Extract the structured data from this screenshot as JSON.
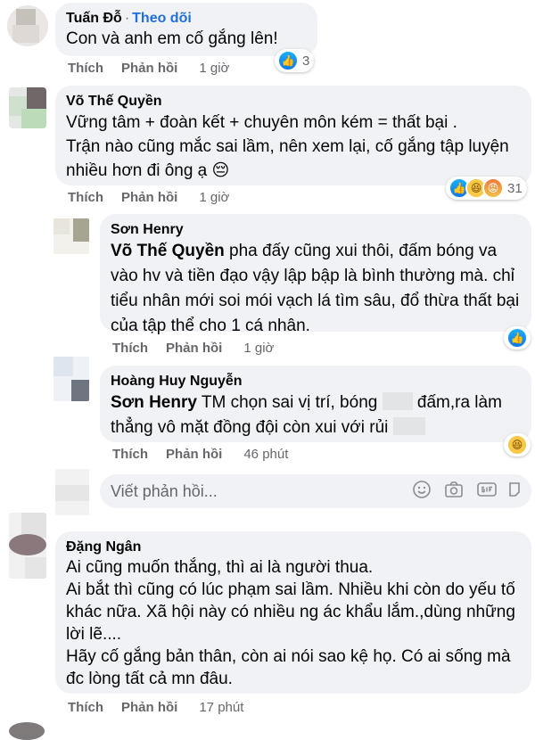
{
  "comments": [
    {
      "author": "Tuấn Đỗ",
      "follow": "Theo dõi",
      "text": "Con và anh em cố gắng lên!",
      "actions": {
        "like": "Thích",
        "reply": "Phản hồi",
        "time": "1 giờ"
      },
      "reaction_count": "3"
    },
    {
      "author": "Võ Thế Quyền",
      "text": "Vững tâm + đoàn kết + chuyên môn kém = thất bại .\nTrận nào cũng mắc sai lầm, nên xem lại, cố gắng tập luyện nhiều hơn đi ông ạ 😔",
      "actions": {
        "like": "Thích",
        "reply": "Phản hồi",
        "time": "1 giờ"
      },
      "reaction_count": "31"
    }
  ],
  "replies": [
    {
      "author": "Sơn Henry",
      "mention": "Võ Thế Quyền",
      "text": " pha đấy cũng xui thôi, đấm bóng va vào hv và tiền đạo vậy lập bập là bình thường mà. chỉ tiểu nhân mới soi mói vạch lá tìm sâu, đổ thừa thất bại của tập thể cho 1 cá nhân.",
      "actions": {
        "like": "Thích",
        "reply": "Phản hồi",
        "time": "1 giờ"
      }
    },
    {
      "author": "Hoàng Huy Nguyễn",
      "mention": "Sơn Henry",
      "text_a": " TM chọn sai vị trí, bóng ",
      "text_b": " đấm,ra làm thẳng vô mặt đồng đội còn xui với rủi",
      "actions": {
        "like": "Thích",
        "reply": "Phản hồi",
        "time": "46 phút"
      }
    }
  ],
  "reply_box": {
    "placeholder": "Viết phản hồi..."
  },
  "comment3": {
    "author": "Đặng Ngân",
    "text": "Ai cũng muốn thắng, thì ai là người thua.\nAi bắt thì cũng có lúc phạm sai lầm. Nhiều khi còn do yếu tố khác nữa. Xã hội này có nhiều ng ác khẩu lắm.,dùng những lời lẽ....\nHãy cố gắng bản thân, còn ai nói sao kệ họ. Có ai sống mà đc lòng tất cả mn đâu.",
    "actions": {
      "like": "Thích",
      "reply": "Phản hồi",
      "time": "17 phút"
    }
  },
  "colors": {
    "bubble": "#f0f2f5",
    "link": "#216fdb",
    "meta": "#65676b"
  },
  "icons": [
    "like-icon",
    "angry-icon",
    "haha-icon",
    "emoji-icon",
    "camera-icon",
    "gif-icon",
    "sticker-icon"
  ]
}
